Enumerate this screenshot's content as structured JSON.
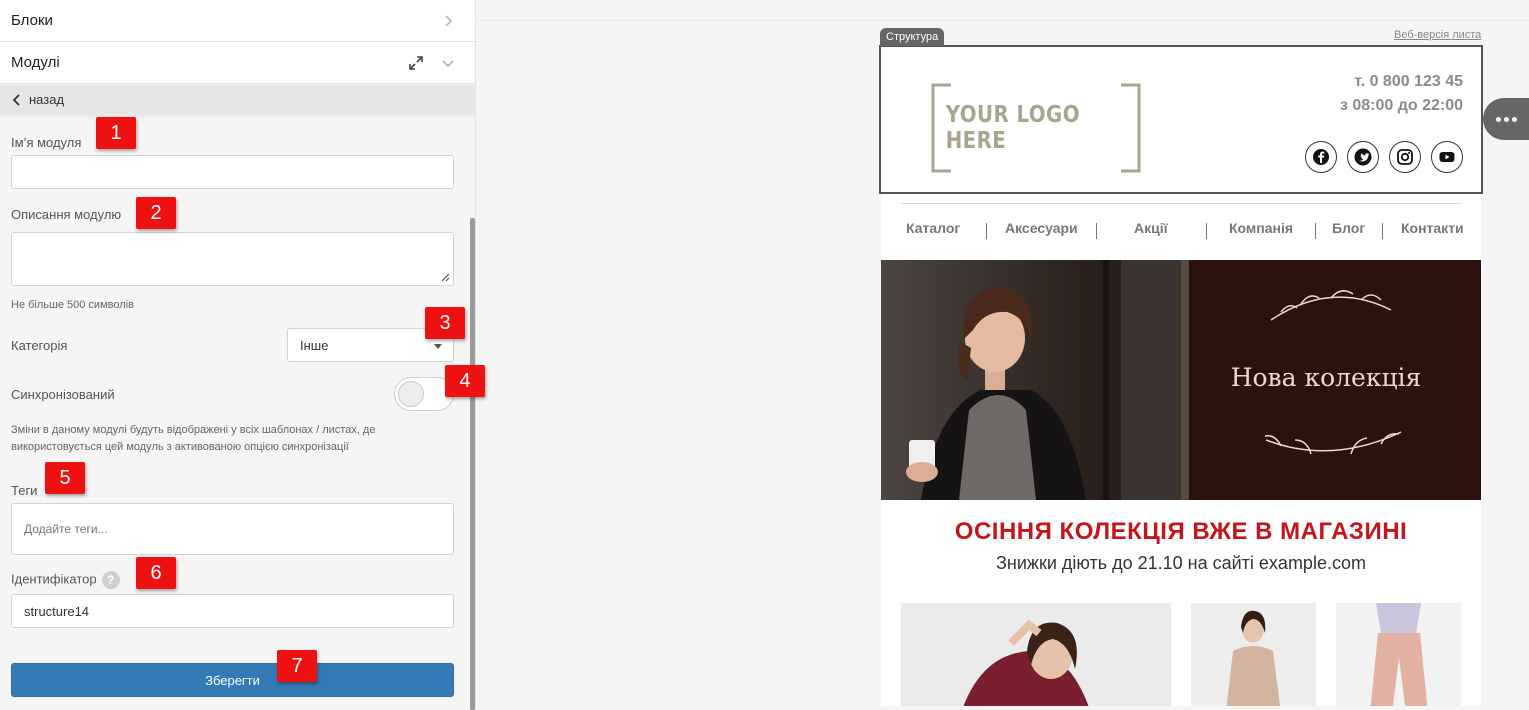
{
  "panel": {
    "blocks_label": "Блоки",
    "modules_label": "Модулі",
    "back_label": "назад",
    "name_label": "Ім’я модуля",
    "name_value": "",
    "desc_label": "Описання модулю",
    "desc_value": "",
    "desc_hint": "Не більше 500 символів",
    "category_label": "Категорія",
    "category_value": "Інше",
    "sync_label": "Синхронізований",
    "sync_enabled": false,
    "sync_hint_line1": "Зміни в даному модулі будуть відображені у всіх шаблонах / листах, де",
    "sync_hint_line2": "використовується цей модуль з активованою опцією синхронізації",
    "tags_label": "Теги",
    "tags_placeholder": "Додайте теги...",
    "id_label": "Ідентифікатор",
    "id_help": "?",
    "id_value": "structure14",
    "save_label": "Зберегти"
  },
  "badges": [
    "1",
    "2",
    "3",
    "4",
    "5",
    "6",
    "7"
  ],
  "email": {
    "structure_tag": "Структура",
    "web_version": "Веб-версія листа",
    "logo_text": "YOUR LOGO HERE",
    "phone": "т. 0 800 123 45",
    "hours": "з 08:00 до 22:00",
    "socials": [
      "facebook-icon",
      "twitter-icon",
      "instagram-icon",
      "youtube-icon"
    ],
    "menu": [
      "Каталог",
      "Аксесуари",
      "Акції",
      "Компанія",
      "Блог",
      "Контакти"
    ],
    "banner_text": "Нова колекція",
    "promo_title": "ОСІННЯ КОЛЕКЦІЯ ВЖЕ В МАГАЗИНІ",
    "promo_sub": "Знижки діють до 21.10 на сайті example.com"
  },
  "colors": {
    "accent_blue": "#337ab7",
    "badge_red": "#ee1111",
    "promo_red": "#c4151c",
    "banner_bg": "#2b120d",
    "banner_text": "#f1d6cb"
  }
}
